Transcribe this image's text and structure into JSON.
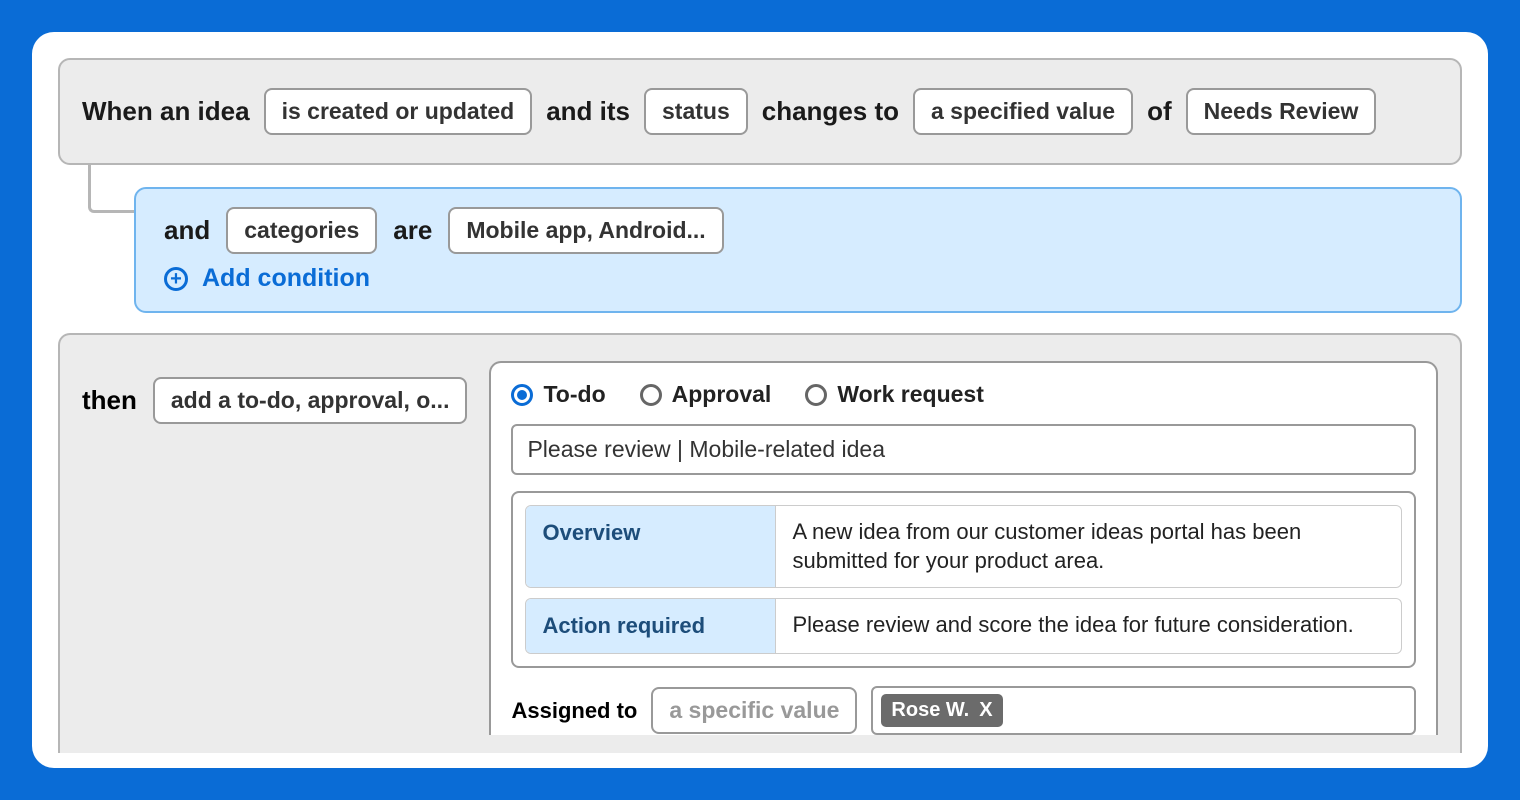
{
  "trigger": {
    "lead_text": "When an idea",
    "event_pill": "is created or updated",
    "and_its": "and its",
    "field_pill": "status",
    "changes_to": "changes to",
    "compare_pill": "a specified value",
    "of": "of",
    "value_pill": "Needs Review"
  },
  "condition": {
    "and": "and",
    "field_pill": "categories",
    "are": "are",
    "value_pill": "Mobile app, Android...",
    "add_label": "Add condition"
  },
  "then": {
    "label": "then",
    "action_pill": "add a to-do, approval, o..."
  },
  "action": {
    "radios": {
      "todo": "To-do",
      "approval": "Approval",
      "work_request": "Work request"
    },
    "title": "Please review | Mobile-related idea",
    "rows": [
      {
        "label": "Overview",
        "value": "A new idea from our customer ideas portal has been submitted for your product area."
      },
      {
        "label": "Action required",
        "value": "Please review and score the idea for future consideration."
      }
    ],
    "assigned_label": "Assigned to",
    "assigned_mode_pill": "a specific value",
    "assignee_chip": "Rose W.",
    "assignee_remove": "X"
  }
}
